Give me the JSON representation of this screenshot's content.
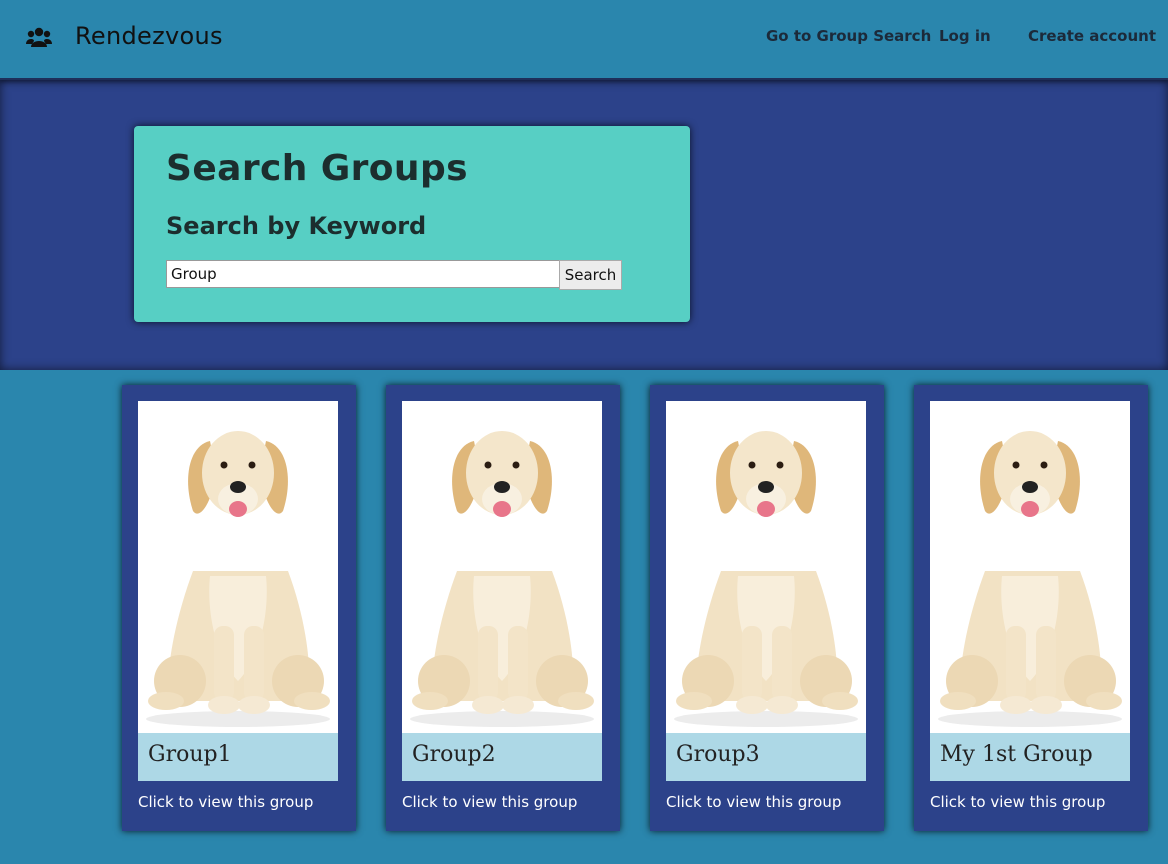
{
  "nav": {
    "brand": "Rendezvous",
    "brand_icon": "users-icon",
    "links": {
      "search": "Go to Group Search",
      "login": "Log in",
      "create": "Create account"
    }
  },
  "search": {
    "title": "Search Groups",
    "subtitle": "Search by Keyword",
    "value": "Group",
    "button": "Search"
  },
  "groups": [
    {
      "name": "Group1",
      "link": "Click to view this group",
      "image": "puppy-image"
    },
    {
      "name": "Group2",
      "link": "Click to view this group",
      "image": "puppy-image"
    },
    {
      "name": "Group3",
      "link": "Click to view this group",
      "image": "puppy-image"
    },
    {
      "name": "My 1st Group",
      "link": "Click to view this group",
      "image": "puppy-image"
    }
  ],
  "colors": {
    "page_bg": "#2a86ad",
    "hero_bg": "#2c428a",
    "search_card": "#57cfc4",
    "card_label": "#add8e6"
  }
}
